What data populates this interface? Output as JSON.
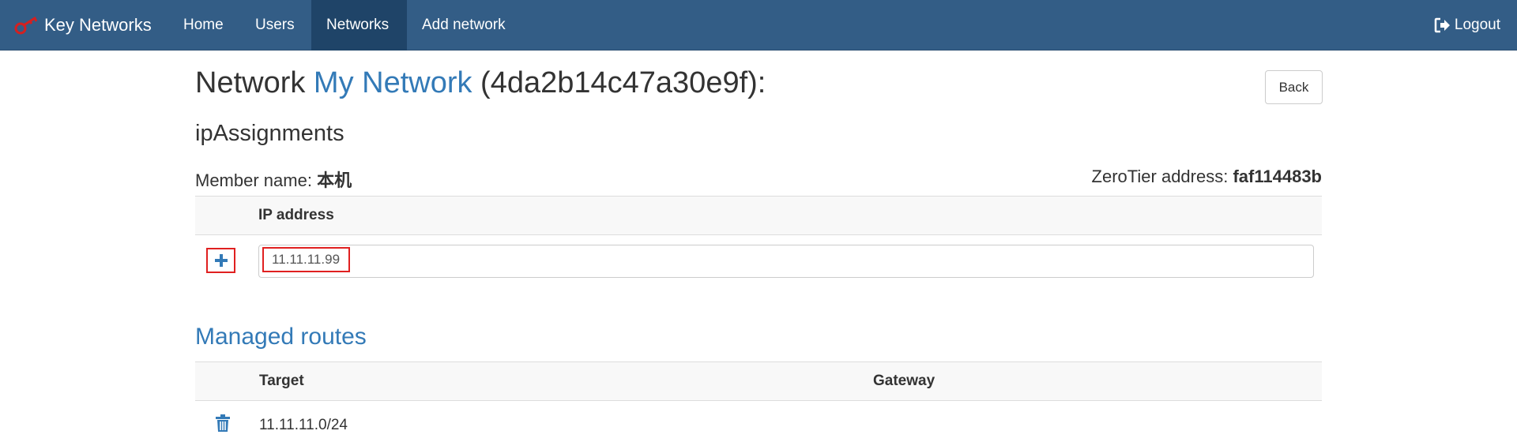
{
  "navbar": {
    "brand": "Key Networks",
    "items": [
      {
        "label": "Home",
        "active": false
      },
      {
        "label": "Users",
        "active": false
      },
      {
        "label": "Networks",
        "active": true
      },
      {
        "label": "Add network",
        "active": false
      }
    ],
    "logout": "Logout"
  },
  "page": {
    "title_prefix": "Network ",
    "network_name": "My Network",
    "network_id": " (4da2b14c47a30e9f):",
    "back": "Back"
  },
  "ip_assignments": {
    "heading": "ipAssignments",
    "member_label": "Member name: ",
    "member_name": "本机",
    "zt_label": "ZeroTier address: ",
    "zt_address": "faf114483b",
    "column": "IP address",
    "input_value": "11.11.11.99"
  },
  "routes": {
    "heading": "Managed routes",
    "columns": [
      "Target",
      "Gateway"
    ],
    "rows": [
      {
        "target": "11.11.11.0/24",
        "gateway": ""
      }
    ]
  },
  "colors": {
    "navbar": "#335d86",
    "nav_active": "#1f4468",
    "link": "#337ab7",
    "highlight": "#e02020"
  },
  "icons": [
    "key-icon",
    "logout-icon",
    "plus-icon",
    "trash-icon"
  ]
}
